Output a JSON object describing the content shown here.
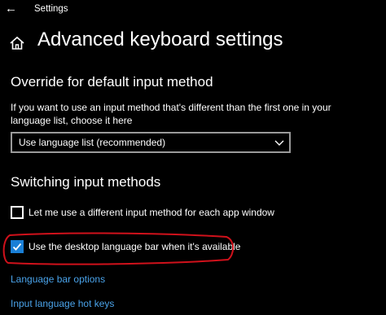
{
  "window": {
    "app_title": "Settings",
    "back_icon": "back-arrow-icon"
  },
  "header": {
    "home_icon": "home-icon",
    "title": "Advanced keyboard settings"
  },
  "override_section": {
    "title": "Override for default input method",
    "description": "If you want to use an input method that's different than the first one in your language list, choose it here",
    "dropdown": {
      "selected": "Use language list (recommended)",
      "chevron_icon": "chevron-down-icon"
    }
  },
  "switching_section": {
    "title": "Switching input methods",
    "options": [
      {
        "label": "Let me use a different input method for each app window",
        "checked": false
      },
      {
        "label": "Use the desktop language bar when it's available",
        "checked": true
      }
    ]
  },
  "links": {
    "language_bar_options": "Language bar options",
    "input_language_hot_keys": "Input language hot keys"
  },
  "colors": {
    "background": "#000000",
    "text": "#ffffff",
    "accent": "#1a7fd6",
    "link": "#4aa3ea",
    "annotation_red": "#d0111b"
  }
}
